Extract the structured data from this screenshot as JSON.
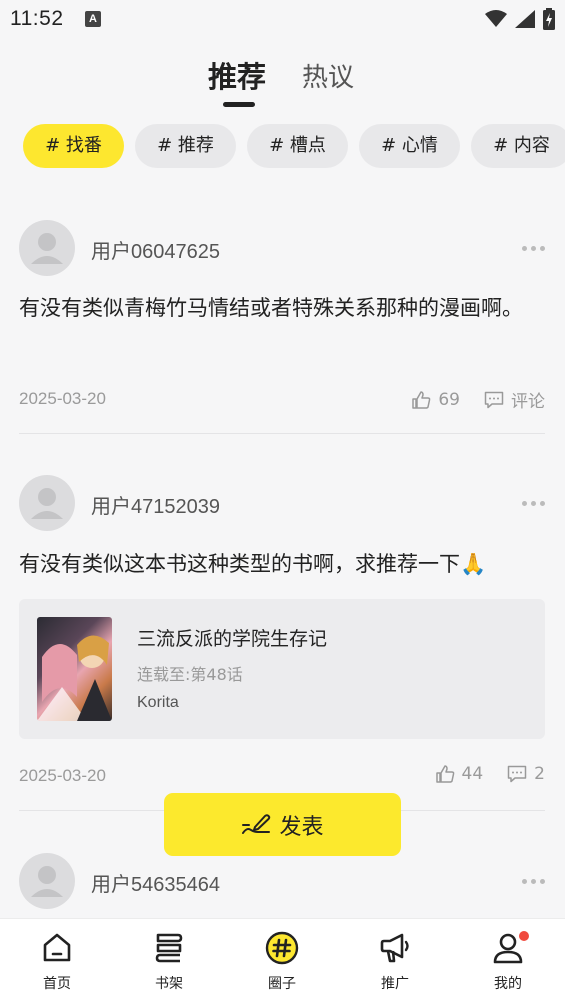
{
  "status": {
    "time": "11:52",
    "app_icon": "A"
  },
  "tabs": [
    {
      "label": "推荐",
      "active": true
    },
    {
      "label": "热议",
      "active": false
    }
  ],
  "chips": [
    {
      "label": "# 找番",
      "active": true
    },
    {
      "label": "# 推荐",
      "active": false
    },
    {
      "label": "# 槽点",
      "active": false
    },
    {
      "label": "# 心情",
      "active": false
    },
    {
      "label": "# 内容",
      "active": false
    }
  ],
  "posts": [
    {
      "user": "用户06047625",
      "text": "有没有类似青梅竹马情结或者特殊关系那种的漫画啊。",
      "date": "2025-03-20",
      "likes": "69",
      "comment_label": "评论"
    },
    {
      "user": "用户47152039",
      "text": "有没有类似这本书这种类型的书啊，求推荐一下🙏",
      "book": {
        "title": "三流反派的学院生存记",
        "progress": "连载至:第48话",
        "author": "Korita"
      },
      "date": "2025-03-20",
      "likes": "44",
      "comments": "2"
    },
    {
      "user": "用户54635464"
    }
  ],
  "publish_label": "发表",
  "nav": [
    {
      "label": "首页",
      "icon": "home-icon"
    },
    {
      "label": "书架",
      "icon": "bookshelf-icon"
    },
    {
      "label": "圈子",
      "icon": "circle-hash-icon"
    },
    {
      "label": "推广",
      "icon": "megaphone-icon"
    },
    {
      "label": "我的",
      "icon": "user-icon"
    }
  ],
  "colors": {
    "accent": "#fde72f",
    "badge": "#f04a3e"
  }
}
